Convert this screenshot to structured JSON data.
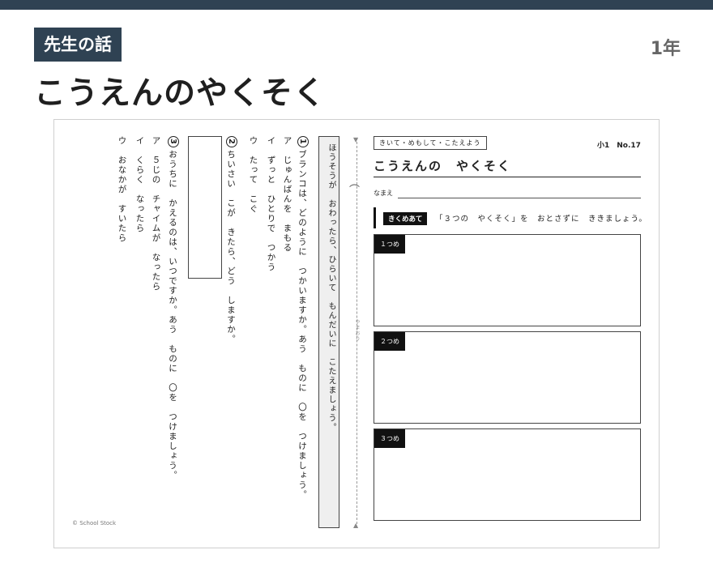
{
  "header": {
    "tag": "先生の話",
    "grade": "1年",
    "title": "こうえんのやくそく"
  },
  "sheet": {
    "instruction": "ほうそうが　おわったら、ひらいて　もんだいに　こたえましょう。",
    "q1": {
      "num": "1",
      "text": "ブランコは、どのように　つかいますか。あう　ものに　〇を　つけましょう。"
    },
    "q1_options": [
      "ア　じゅんばんを　まもる",
      "イ　ずっと　ひとりで　つかう",
      "ウ　たって　こぐ"
    ],
    "q2": {
      "num": "2",
      "text": "ちいさい　こが　きたら、どう　しますか。"
    },
    "q3": {
      "num": "3",
      "text": "おうちに　かえるのは、いつですか。あう　ものに　〇を　つけましょう。"
    },
    "q3_options": [
      "ア　５じの　チャイムが　なったら",
      "イ　くらく　なったら",
      "ウ　おなかが　すいたら"
    ],
    "fold_label": "やまおり",
    "copyright": "© School Stock",
    "right": {
      "head": "きいて・めもして・こたえよう",
      "number": "小1　No.17",
      "title": "こうえんの　やくそく",
      "name_label": "なまえ",
      "goal_tag": "きくめあて",
      "goal_text": "「３つの　やくそく」を　おとさずに　ききましょう。",
      "boxes": [
        "１つめ",
        "２つめ",
        "３つめ"
      ]
    }
  }
}
